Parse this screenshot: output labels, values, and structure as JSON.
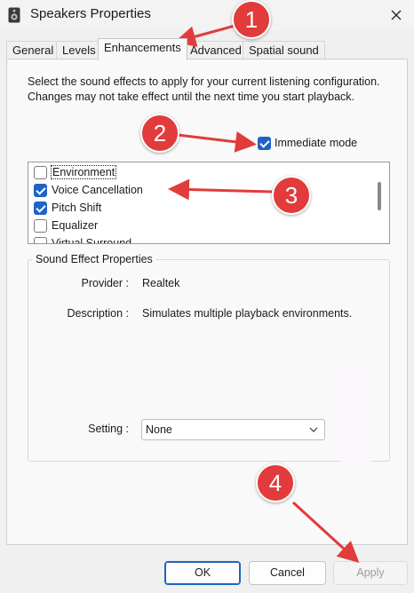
{
  "window": {
    "title": "Speakers Properties"
  },
  "tabs": [
    {
      "label": "General"
    },
    {
      "label": "Levels"
    },
    {
      "label": "Enhancements"
    },
    {
      "label": "Advanced"
    },
    {
      "label": "Spatial sound"
    }
  ],
  "active_tab": "Enhancements",
  "intro_text": "Select the sound effects to apply for your current listening configuration. Changes may not take effect until the next time you start playback.",
  "immediate_mode": {
    "label": "Immediate mode",
    "checked": true
  },
  "effects": [
    {
      "label": "Environment",
      "checked": false
    },
    {
      "label": "Voice Cancellation",
      "checked": true
    },
    {
      "label": "Pitch Shift",
      "checked": true
    },
    {
      "label": "Equalizer",
      "checked": false
    },
    {
      "label": "Virtual Surround",
      "checked": false
    }
  ],
  "effect_properties": {
    "group_title": "Sound Effect Properties",
    "provider_label": "Provider :",
    "provider_value": "Realtek",
    "description_label": "Description :",
    "description_value": "Simulates multiple playback environments.",
    "setting_label": "Setting :",
    "setting_value": "None"
  },
  "buttons": {
    "ok": "OK",
    "cancel": "Cancel",
    "apply": "Apply"
  },
  "annotations": [
    "1",
    "2",
    "3",
    "4"
  ],
  "colors": {
    "accent": "#1f63c4",
    "annotation": "#e23b3b"
  },
  "icons": {
    "app": "speaker-icon",
    "close": "close-icon",
    "dropdown": "chevron-down-icon"
  }
}
